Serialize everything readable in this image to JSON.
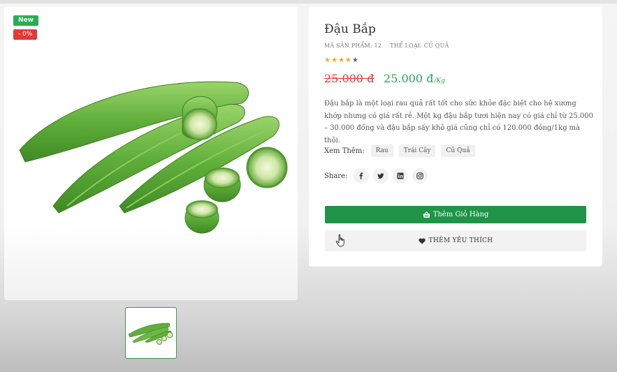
{
  "product": {
    "badges": {
      "new": "New",
      "discount": "- 0%"
    },
    "title": "Đậu Bắp",
    "sku_label": "MÃ SẢN PHẨM: 12",
    "category_label": "THỂ LOẠI: CỦ QUẢ",
    "rating": {
      "filled": 4,
      "total": 5
    },
    "price_old": "25.000 đ",
    "price_new": "25.000 đ",
    "price_unit": "/Kg",
    "description": "Đậu bắp là một loại rau quả rất tốt cho sức khỏe đặc biệt cho hệ xương khớp nhưng có giá rất rẻ. Một kg đậu bắp tươi hiện nay có giá chỉ từ 25.000 – 30.000 đồng và đậu bắp sấy khô giá cũng chỉ có 120.000 đồng/1kg mà thôi.",
    "see_more_label": "Xem Thêm:",
    "tags": [
      "Rau",
      "Trái Cây",
      "Củ Quả"
    ],
    "share_label": "Share:",
    "social_icons": [
      "facebook-icon",
      "twitter-icon",
      "linkedin-icon",
      "instagram-icon"
    ],
    "add_to_cart_label": "Thêm Giỏ Hàng",
    "add_to_wishlist_label": "THÊM YÊU THÍCH"
  },
  "colors": {
    "primary_green": "#1f9447",
    "price_green": "#27a455",
    "sale_red": "#e53935",
    "star": "#f5a623"
  }
}
